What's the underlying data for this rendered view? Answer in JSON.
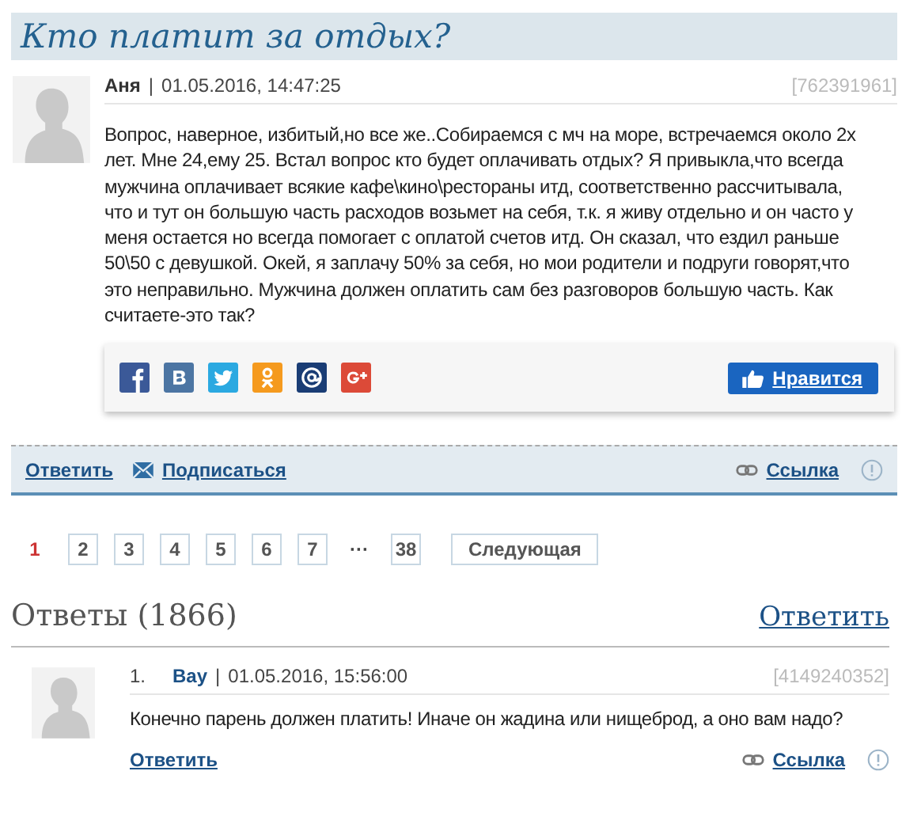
{
  "question": {
    "title": "Кто платит за отдых?",
    "author": "Аня",
    "separator": "|",
    "date": "01.05.2016, 14:47:25",
    "id": "[762391961]",
    "text": "Вопрос, наверное, избитый,но все же..Собираемся с мч на море, встречаемся около 2х лет. Мне 24,ему 25. Встал вопрос кто будет оплачивать отдых? Я привыкла,что всегда мужчина оплачивает всякие кафе\\кино\\рестораны итд, соответственно рассчитывала, что и тут он большую часть расходов возьмет на себя, т.к. я живу отдельно и он часто у меня остается но всегда помогает с оплатой счетов итд. Он сказал, что ездил раньше 50\\50 с девушкой. Окей, я заплачу 50% за себя, но мои родители и подруги говорят,что это неправильно. Мужчина должен оплатить сам без разговоров большую часть. Как считаете-это так?",
    "share": [
      {
        "kind": "facebook",
        "color": "#3b5998"
      },
      {
        "kind": "vk",
        "color": "#4c75a3"
      },
      {
        "kind": "twitter",
        "color": "#2ba9e1"
      },
      {
        "kind": "ok",
        "color": "#f59a1e"
      },
      {
        "kind": "mail",
        "color": "#1a3d75"
      },
      {
        "kind": "gplus",
        "color": "#dc4a38"
      }
    ],
    "like": "Нравится",
    "reply": "Ответить",
    "subscribe": "Подписаться",
    "link": "Ссылка"
  },
  "pagination": {
    "pages": [
      {
        "label": "1",
        "selected": true
      },
      {
        "label": "2",
        "selected": false
      },
      {
        "label": "3",
        "selected": false
      },
      {
        "label": "4",
        "selected": false
      },
      {
        "label": "5",
        "selected": false
      },
      {
        "label": "6",
        "selected": false
      },
      {
        "label": "7",
        "selected": false
      }
    ],
    "ellipsis": "···",
    "last": "38",
    "next": "Следующая"
  },
  "answers": {
    "heading": "Ответы (1866)",
    "reply": "Ответить",
    "items": [
      {
        "number": "1.",
        "author": "Bay",
        "separator": "|",
        "date": "01.05.2016, 15:56:00",
        "id": "[4149240352]",
        "text": "Конечно парень должен платить! Иначе он жадина или нищеброд, а оно вам надо?",
        "reply": "Ответить",
        "link": "Ссылка"
      }
    ]
  }
}
